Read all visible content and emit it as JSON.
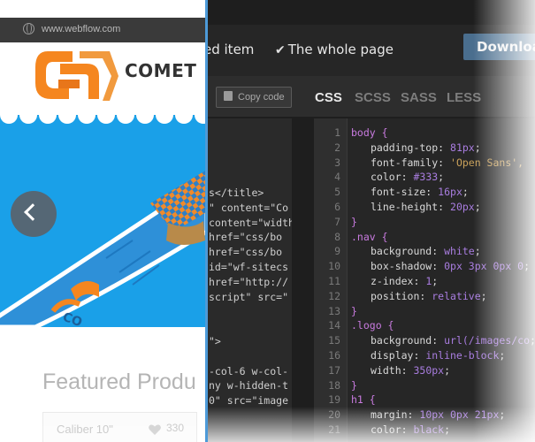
{
  "browser": {
    "url": "www.webflow.com",
    "logo_text": "COMET",
    "featured_title": "Featured Produ",
    "product_name": "Caliber 10\"",
    "like_count": "330"
  },
  "export": {
    "option_selected_item": "ed item",
    "option_whole_page": "The whole page",
    "download_label": "Downloa",
    "copy_label": "Copy code",
    "tabs": [
      "CSS",
      "SCSS",
      "SASS",
      "LESS"
    ],
    "active_tab": "CSS"
  },
  "html_lines": [
    "s</title>",
    "\" content=\"Co",
    "content=\"width",
    "href=\"css/bo",
    "href=\"css/bo",
    "id=\"wf-sitecs",
    "href=\"http://",
    "script\" src=\"",
    "",
    "",
    "\">",
    "",
    "-col-6 w-col-",
    "ny w-hidden-t",
    "0\" src=\"image"
  ],
  "css_lines": [
    {
      "n": "1",
      "text": "body {",
      "kind": "sel"
    },
    {
      "n": "2",
      "text": "padding-top: ",
      "val": "81px",
      "kind": "decl"
    },
    {
      "n": "3",
      "text": "font-family: ",
      "val": "'Open Sans',",
      "kind": "decl-str"
    },
    {
      "n": "4",
      "text": "color: ",
      "val": "#333",
      "kind": "decl"
    },
    {
      "n": "5",
      "text": "font-size: ",
      "val": "16px",
      "kind": "decl"
    },
    {
      "n": "6",
      "text": "line-height: ",
      "val": "20px",
      "kind": "decl"
    },
    {
      "n": "7",
      "text": "}",
      "kind": "sel"
    },
    {
      "n": "8",
      "text": ".nav {",
      "kind": "sel"
    },
    {
      "n": "9",
      "text": "background: ",
      "val": "white",
      "kind": "decl"
    },
    {
      "n": "10",
      "text": "box-shadow: ",
      "val": "0px 3px 0px 0",
      "kind": "decl"
    },
    {
      "n": "11",
      "text": "z-index: ",
      "val": "1",
      "kind": "decl"
    },
    {
      "n": "12",
      "text": "position: ",
      "val": "relative",
      "kind": "decl"
    },
    {
      "n": "13",
      "text": "}",
      "kind": "sel"
    },
    {
      "n": "14",
      "text": ".logo {",
      "kind": "sel"
    },
    {
      "n": "15",
      "text": "background: ",
      "val": "url(/images/co",
      "kind": "decl"
    },
    {
      "n": "16",
      "text": "display: ",
      "val": "inline-block",
      "kind": "decl"
    },
    {
      "n": "17",
      "text": "width: ",
      "val": "350px",
      "kind": "decl"
    },
    {
      "n": "18",
      "text": "}",
      "kind": "sel"
    },
    {
      "n": "19",
      "text": "h1 {",
      "kind": "sel"
    },
    {
      "n": "20",
      "text": "margin: ",
      "val": "10px 0px 21px",
      "kind": "decl"
    },
    {
      "n": "21",
      "text": "color: ",
      "val": "black",
      "kind": "decl"
    }
  ],
  "colors": {
    "accent_blue": "#4d9ad8",
    "hero_blue": "#1aa0e8",
    "logo_orange": "#f5861f",
    "selector_purple": "#c97be0",
    "value_purple": "#a97de0"
  }
}
